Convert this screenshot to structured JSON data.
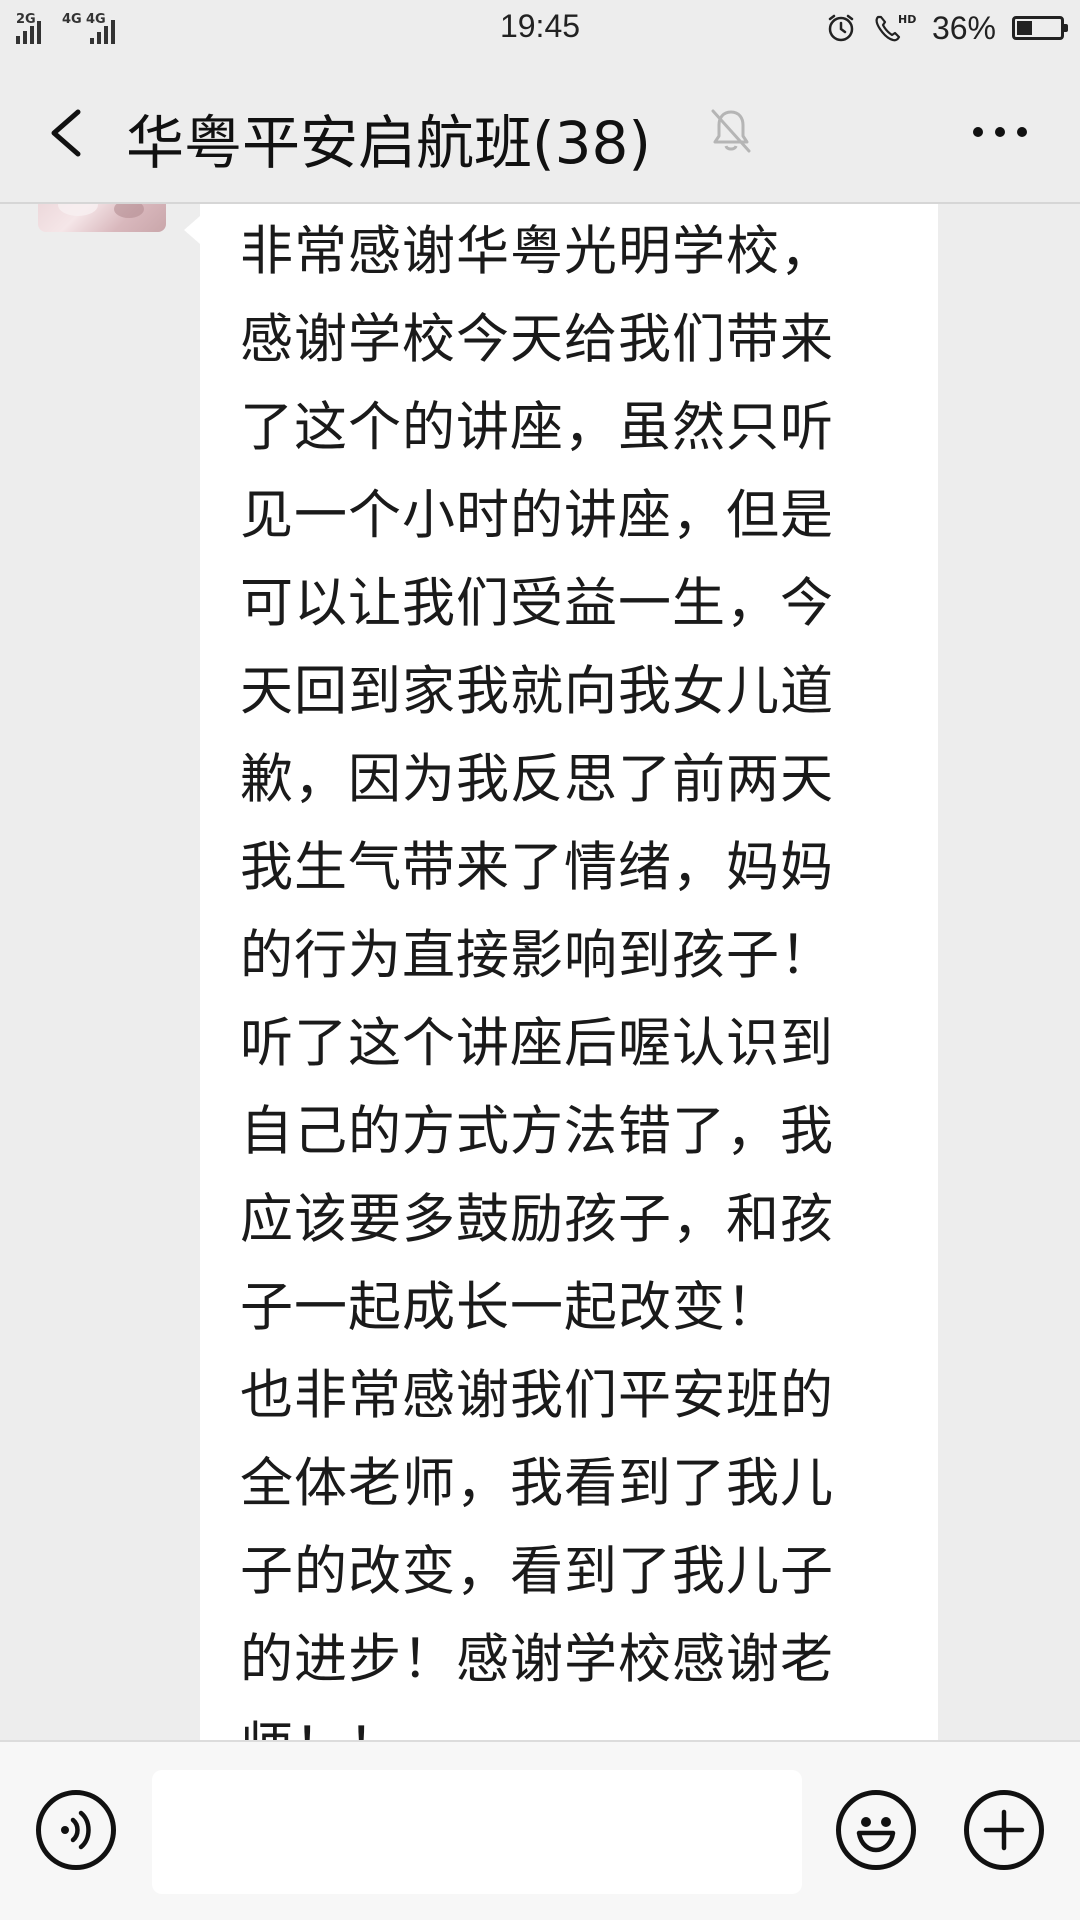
{
  "status_bar": {
    "network_left": "2G",
    "network_right": "4G",
    "network_right_2": "4G",
    "time": "19:45",
    "battery_percent": "36%",
    "battery_level": 0.36,
    "icons": [
      "alarm-icon",
      "hd-call-icon",
      "battery-icon"
    ]
  },
  "header": {
    "title": "华粤平安启航班(38)",
    "back_icon": "chevron-left-icon",
    "mute_icon": "bell-muted-icon",
    "more_icon": "more-dots-icon"
  },
  "message": {
    "text": "非常感谢华粤光明学校，\n感谢学校今天给我们带来\n了这个的讲座，虽然只听\n见一个小时的讲座，但是\n可以让我们受益一生，今\n天回到家我就向我女儿道\n歉，因为我反思了前两天\n我生气带来了情绪，妈妈\n的行为直接影响到孩子！\n听了这个讲座后喔认识到\n自己的方式方法错了，我\n应该要多鼓励孩子，和孩\n子一起成长一起改变！\n也非常感谢我们平安班的\n全体老师，我看到了我儿\n子的改变，看到了我儿子\n的进步！感谢学校感谢老\n师！！"
  },
  "input_bar": {
    "value": "",
    "voice_icon": "voice-icon",
    "emoji_icon": "emoji-icon",
    "plus_icon": "plus-icon"
  }
}
